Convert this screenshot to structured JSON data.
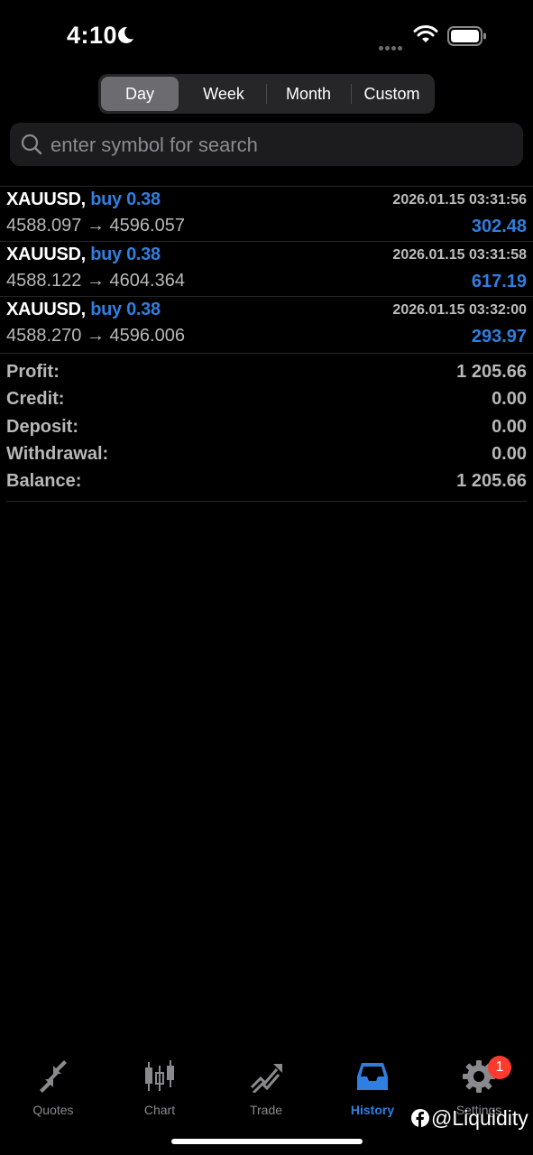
{
  "status_bar": {
    "time": "4:10"
  },
  "period_tabs": [
    {
      "label": "Day",
      "active": true
    },
    {
      "label": "Week",
      "active": false
    },
    {
      "label": "Month",
      "active": false
    },
    {
      "label": "Custom",
      "active": false
    }
  ],
  "search": {
    "placeholder": "enter symbol for search",
    "value": ""
  },
  "deals": [
    {
      "symbol": "XAUUSD,",
      "side": "buy 0.38",
      "time": "2026.01.15 03:31:56",
      "open": "4588.097",
      "close": "4596.057",
      "profit": "302.48"
    },
    {
      "symbol": "XAUUSD,",
      "side": "buy 0.38",
      "time": "2026.01.15 03:31:58",
      "open": "4588.122",
      "close": "4604.364",
      "profit": "617.19"
    },
    {
      "symbol": "XAUUSD,",
      "side": "buy 0.38",
      "time": "2026.01.15 03:32:00",
      "open": "4588.270",
      "close": "4596.006",
      "profit": "293.97"
    }
  ],
  "arrow": "→",
  "summary": [
    {
      "label": "Profit:",
      "value": "1 205.66"
    },
    {
      "label": "Credit:",
      "value": "0.00"
    },
    {
      "label": "Deposit:",
      "value": "0.00"
    },
    {
      "label": "Withdrawal:",
      "value": "0.00"
    },
    {
      "label": "Balance:",
      "value": "1 205.66"
    }
  ],
  "tabbar": [
    {
      "label": "Quotes",
      "icon": "quotes-icon",
      "active": false
    },
    {
      "label": "Chart",
      "icon": "candlestick-icon",
      "active": false
    },
    {
      "label": "Trade",
      "icon": "trade-icon",
      "active": false
    },
    {
      "label": "History",
      "icon": "inbox-icon",
      "active": true
    },
    {
      "label": "Settings",
      "icon": "gear-icon",
      "active": false
    }
  ],
  "settings_badge": "1",
  "watermark": "@Liquidity",
  "colors": {
    "accent": "#2f7fe0",
    "background": "#000000",
    "badge": "#ff3b30"
  }
}
